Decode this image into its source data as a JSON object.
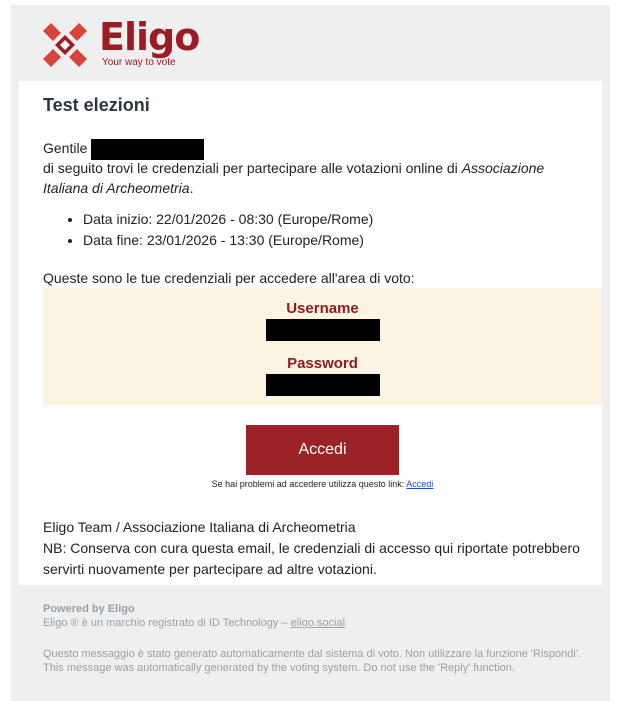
{
  "brand": {
    "name": "Eligo",
    "tagline": "Your way to vote",
    "color": "#9b1c24"
  },
  "email": {
    "title": "Test elezioni",
    "greeting": "Gentile",
    "intro_main": "di seguito trovi le credenziali per partecipare alle votazioni online di ",
    "intro_org": "Associazione Italiana di Archeometria",
    "intro_end": ".",
    "dates": [
      "Data inizio: 22/01/2026 - 08:30 (Europe/Rome)",
      "Data fine: 23/01/2026 - 13:30 (Europe/Rome)"
    ],
    "cred_title": "Queste sono le tue credenziali per accedere all'area di voto:",
    "username_label": "Username",
    "password_label": "Password",
    "button_label": "Accedi",
    "help_text": "Se hai problemi ad accedere utilizza questo link: ",
    "help_link": "Accedi",
    "signature": "Eligo Team / Associazione Italiana di Archeometria",
    "nb": "NB: Conserva con cura questa email, le credenziali di accesso qui riportate potrebbero servirti nuovamente per partecipare ad altre votazioni."
  },
  "footer": {
    "powered": "Powered by Eligo",
    "trademark": "Eligo ® è un marchio registrato di ID Technology – ",
    "site_link": "eligo.social",
    "disclaimer": "Questo messaggio è stato generato automaticamente dal sistema di voto. Non utilizzare la funzione 'Rispondi'. This message was automatically generated by the voting system. Do not use the 'Reply' function."
  }
}
